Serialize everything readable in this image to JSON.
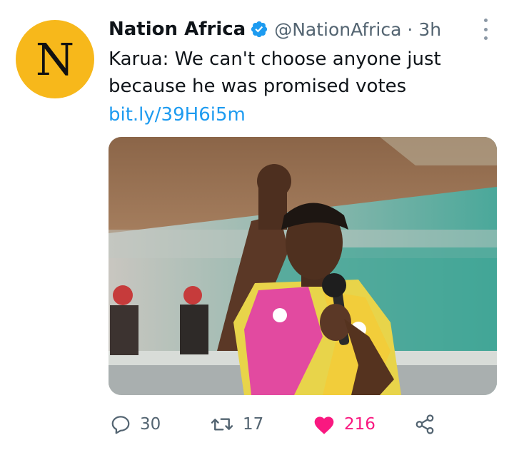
{
  "tweet": {
    "avatar_letter": "N",
    "display_name": "Nation Africa",
    "handle": "@NationAfrica",
    "separator": "·",
    "time": "3h",
    "text": "Karua: We can't choose anyone just because he was promised votes",
    "link": "bit.ly/39H6i5m"
  },
  "actions": {
    "replies": "30",
    "retweets": "17",
    "likes": "216"
  },
  "colors": {
    "avatar_bg": "#f7b81b",
    "link": "#1d9bf0",
    "like": "#f91880",
    "verified": "#1d9bf0"
  },
  "icons": [
    "verified-badge-icon",
    "more-options-icon",
    "reply-icon",
    "retweet-icon",
    "like-heart-icon",
    "share-icon"
  ]
}
